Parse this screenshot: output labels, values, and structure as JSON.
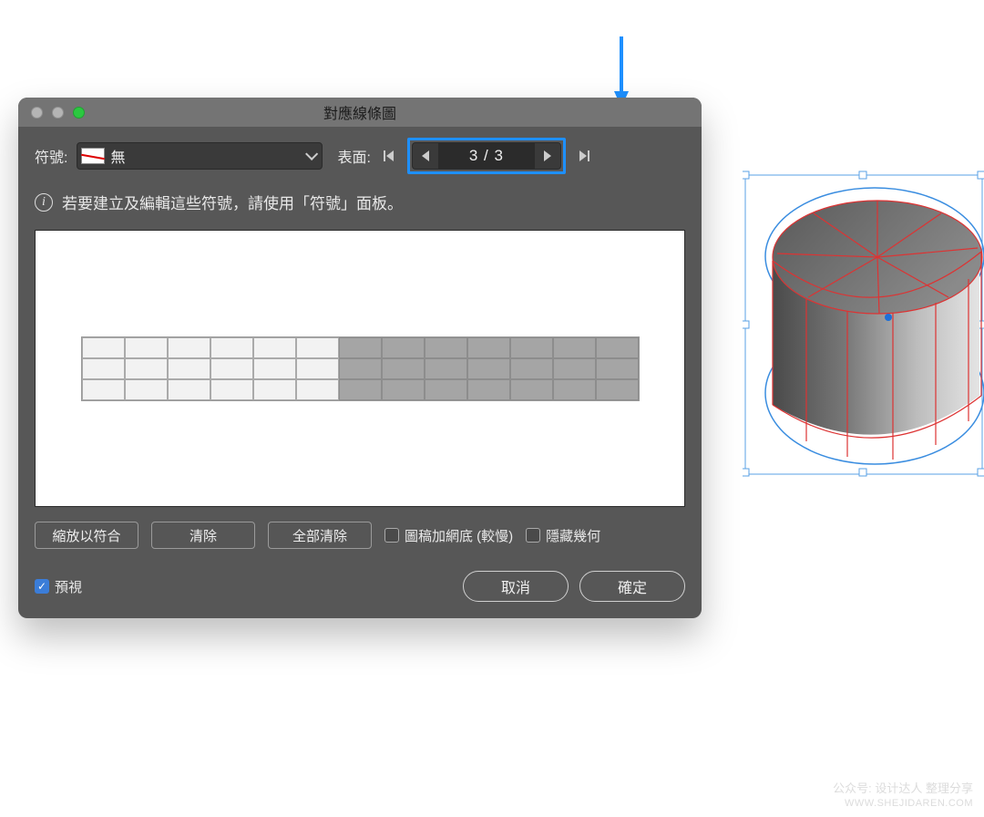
{
  "dialog": {
    "title": "對應線條圖",
    "symbol_label": "符號:",
    "symbol_value": "無",
    "surface_label": "表面:",
    "surface_page": "3 / 3",
    "info_text": "若要建立及編輯這些符號，請使用「符號」面板。",
    "buttons": {
      "scale_to_fit": "縮放以符合",
      "clear": "清除",
      "clear_all": "全部清除"
    },
    "checkboxes": {
      "shade_artwork": "圖稿加網底 (較慢)",
      "hide_geometry": "隱藏幾何",
      "preview": "預視"
    },
    "footer": {
      "cancel": "取消",
      "ok": "確定"
    },
    "preview_grid": {
      "rows": 3,
      "light_cols": 6,
      "dark_cols": 7
    }
  },
  "annotation": {
    "arrow_color": "#1e90ff"
  },
  "watermark": {
    "line1": "公众号: 设计达人 整理分享",
    "line2": "WWW.SHEJIDAREN.COM"
  }
}
